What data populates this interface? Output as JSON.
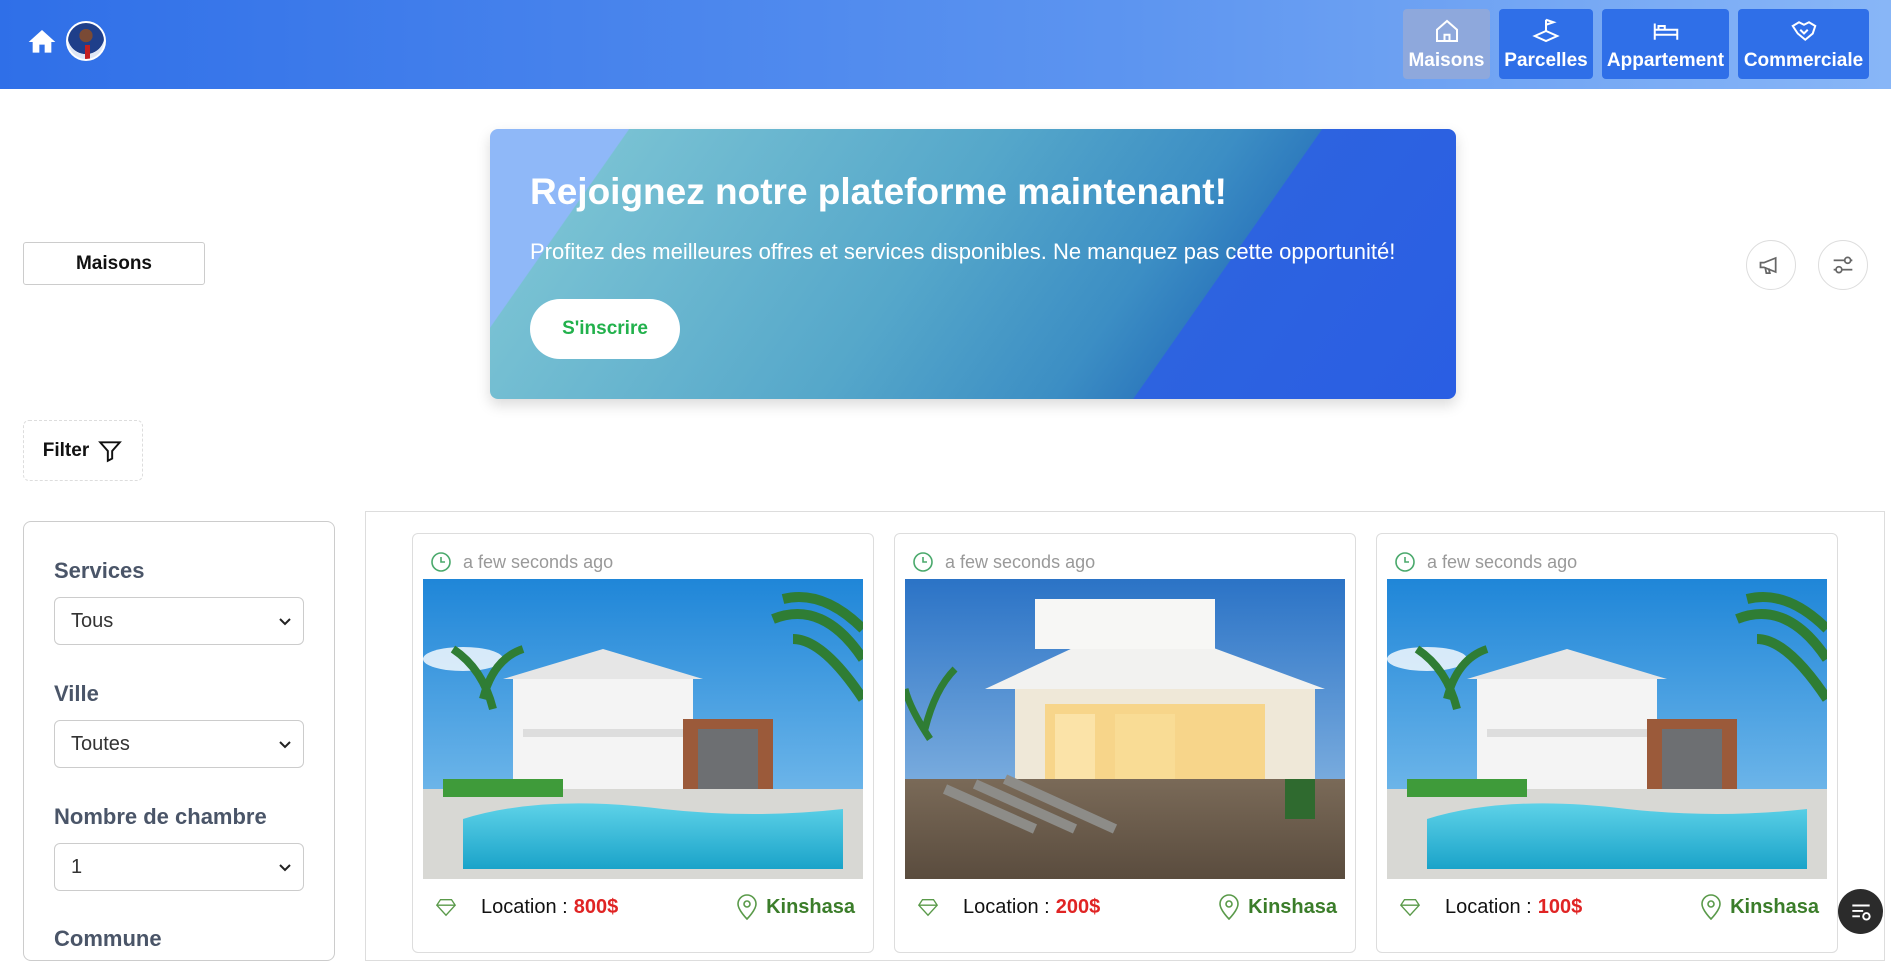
{
  "header": {
    "tabs": [
      {
        "label": "Maisons",
        "icon": "home-icon",
        "active": true
      },
      {
        "label": "Parcelles",
        "icon": "land-plot-icon",
        "active": false
      },
      {
        "label": "Appartement",
        "icon": "bed-icon",
        "active": false
      },
      {
        "label": "Commerciale",
        "icon": "handshake-icon",
        "active": false
      }
    ],
    "colors": {
      "bar_start": "#2f6fe8",
      "bar_end": "#88b6f7",
      "tab_bg": "#2f6fe8",
      "tab_active_bg": "#8ea8dc"
    }
  },
  "category_button": "Maisons",
  "banner": {
    "title": "Rejoignez notre plateforme maintenant!",
    "subtitle": "Profitez des meilleures offres et services disponibles. Ne manquez pas cette opportunité!",
    "cta": "S'inscrire",
    "cta_color": "#22b14c"
  },
  "filter_button": "Filter",
  "filters": {
    "services": {
      "label": "Services",
      "value": "Tous"
    },
    "ville": {
      "label": "Ville",
      "value": "Toutes"
    },
    "chambres": {
      "label": "Nombre de chambre",
      "value": "1"
    },
    "commune": {
      "label": "Commune"
    }
  },
  "listings": [
    {
      "time": "a few seconds ago",
      "location_label": "Location :",
      "price": "800$",
      "city": "Kinshasa",
      "image": "house-pool-photo"
    },
    {
      "time": "a few seconds ago",
      "location_label": "Location :",
      "price": "200$",
      "city": "Kinshasa",
      "image": "house-deck-photo"
    },
    {
      "time": "a few seconds ago",
      "location_label": "Location :",
      "price": "100$",
      "city": "Kinshasa",
      "image": "house-pool-photo"
    }
  ],
  "price_color": "#e02424",
  "city_color": "#3b7d2a"
}
